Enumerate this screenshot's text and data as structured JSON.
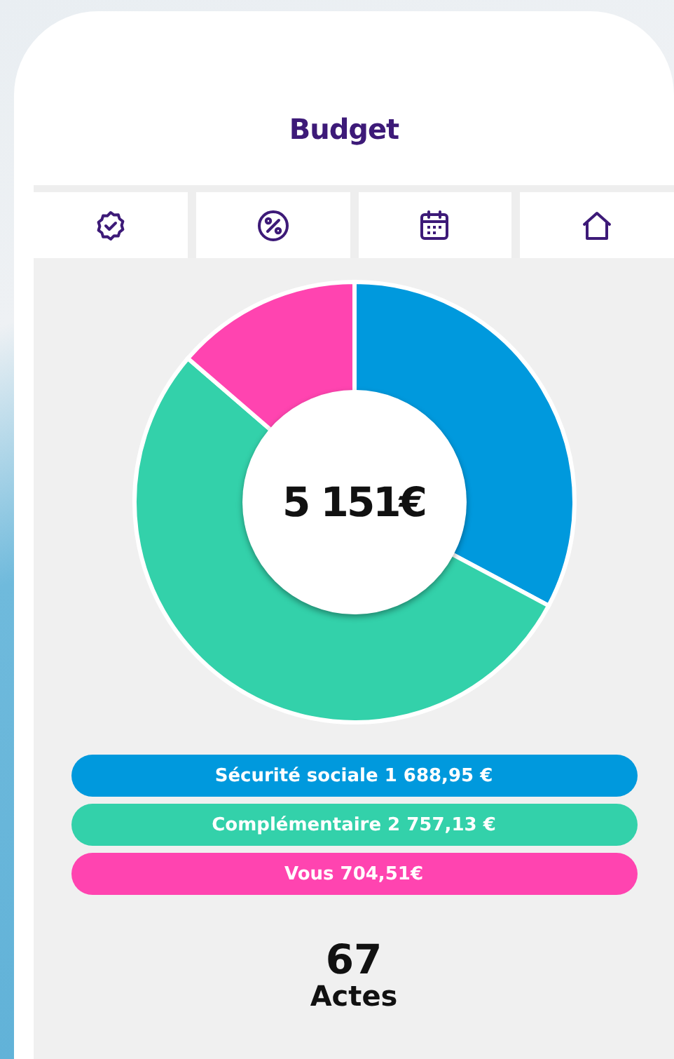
{
  "header": {
    "title": "Budget"
  },
  "tabs": [
    {
      "kind": "badge",
      "selected": false
    },
    {
      "kind": "percent",
      "selected": false
    },
    {
      "kind": "calendar",
      "selected": false
    },
    {
      "kind": "home",
      "selected": false
    }
  ],
  "chart": {
    "total": "5 151€",
    "chart_data": {
      "type": "donut",
      "values": [
        32.79,
        53.53,
        13.68
      ]
    }
  },
  "legend": [
    {
      "label": "Sécurité sociale 1 688,95 €",
      "color": "#0099dd"
    },
    {
      "label": "Complémentaire 2 757,13 €",
      "color": "#33d1aa"
    },
    {
      "label": "Vous 704,51€",
      "color": "#ff44b0"
    }
  ],
  "summary": {
    "count": "67",
    "label": "Actes"
  }
}
